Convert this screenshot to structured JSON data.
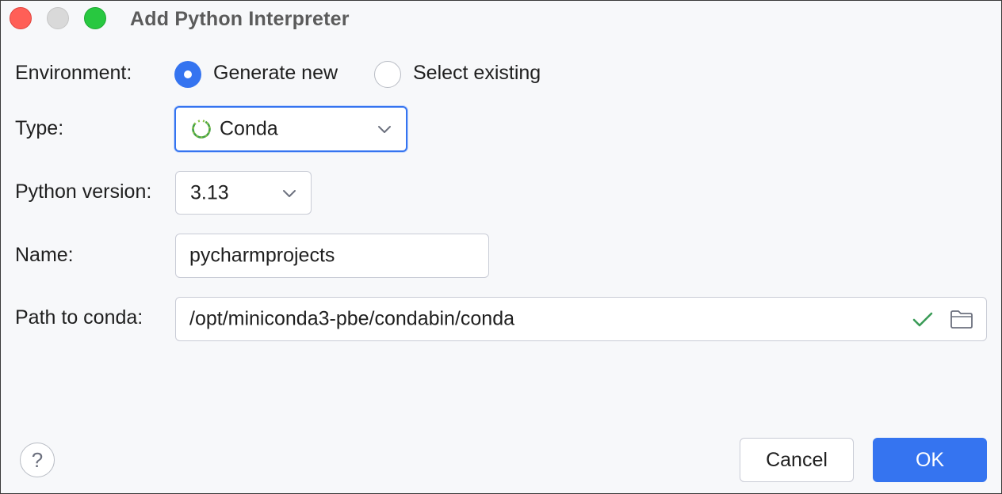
{
  "window": {
    "title": "Add Python Interpreter"
  },
  "environment": {
    "label": "Environment:",
    "options": [
      {
        "label": "Generate new",
        "selected": true
      },
      {
        "label": "Select existing",
        "selected": false
      }
    ]
  },
  "type": {
    "label": "Type:",
    "value": "Conda",
    "icon": "conda-icon"
  },
  "python_version": {
    "label": "Python version:",
    "value": "3.13"
  },
  "name": {
    "label": "Name:",
    "value": "pycharmprojects"
  },
  "path_to_conda": {
    "label": "Path to conda:",
    "value": "/opt/miniconda3-pbe/condabin/conda",
    "status_icon": "checkmark-icon",
    "browse_icon": "folder-icon"
  },
  "footer": {
    "help_label": "?",
    "cancel_label": "Cancel",
    "ok_label": "OK"
  },
  "colors": {
    "accent": "#3574f0",
    "valid": "#3a9b57",
    "traffic_close": "#ff5f57",
    "traffic_min": "#d9d9d9",
    "traffic_max": "#28c840"
  }
}
